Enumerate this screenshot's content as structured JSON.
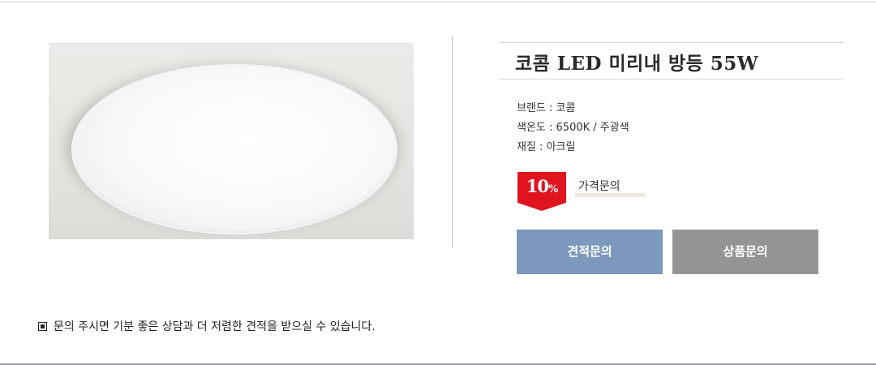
{
  "product": {
    "title": "코콤 LED 미리내 방등 55W",
    "specs": [
      "브랜드 : 코콤",
      "색온도 : 6500K / 주광색",
      "재질 : 아크릴"
    ],
    "discount": "10",
    "discount_unit": "%",
    "price_label": "가격문의",
    "image_icon": "ceiling-lamp-photo"
  },
  "buttons": {
    "quote_label": "견적문의",
    "product_inquiry_label": "상품문의"
  },
  "notice": {
    "text": "문의 주시면 기분 좋은 상담과 더 저렴한 견적을 받으실 수 있습니다."
  },
  "colors": {
    "badge_red": "#e0141e",
    "quote_button": "#7c99bd",
    "inquiry_button": "#959595"
  }
}
